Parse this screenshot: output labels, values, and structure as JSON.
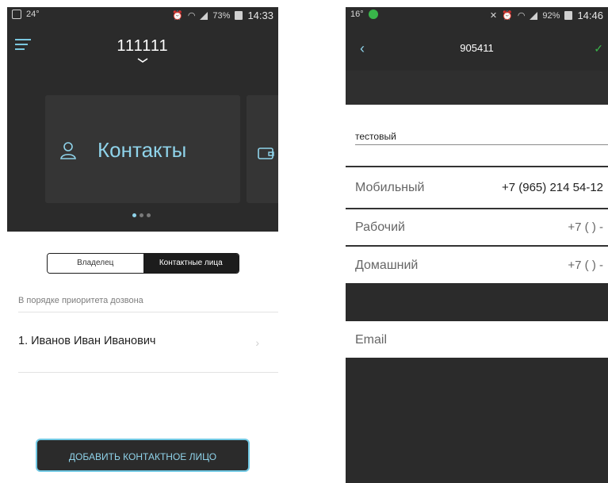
{
  "left": {
    "status": {
      "left_text": "24°",
      "battery": "73%",
      "time": "14:33"
    },
    "title": "111111",
    "card": {
      "label": "Контакты",
      "icon": "person-icon",
      "next_icon": "wallet-icon"
    },
    "pager": {
      "count": 3,
      "active_index": 0
    },
    "segment": {
      "owner": "Владелец",
      "contacts": "Контактные лица"
    },
    "note": "В порядке приоритета дозвона",
    "contacts": [
      "1. Иванов Иван Иванович"
    ],
    "add_button": "ДОБАВИТЬ КОНТАКТНОЕ ЛИЦО",
    "colors": {
      "accent": "#8fd3ea",
      "dark": "#2b2b2b"
    }
  },
  "right": {
    "status": {
      "left_text": "16°",
      "battery": "92%",
      "time": "14:46"
    },
    "title": "905411",
    "name": "тестовый",
    "phones": [
      {
        "label": "Мобильный",
        "value": "+7 (965) 214 54-12"
      },
      {
        "label": "Рабочий",
        "value": "+7 (  )    -"
      },
      {
        "label": "Домашний",
        "value": "+7 (  )    -"
      }
    ],
    "email_label": "Email",
    "colors": {
      "confirm": "#39b54a"
    }
  }
}
